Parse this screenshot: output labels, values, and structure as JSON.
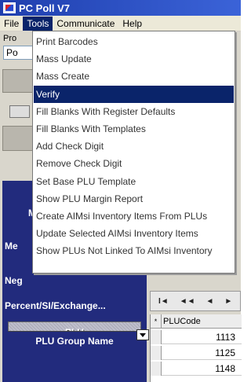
{
  "window": {
    "title": "PC Poll V7"
  },
  "menubar": {
    "items": [
      {
        "label": "File"
      },
      {
        "label": "Tools"
      },
      {
        "label": "Communicate"
      },
      {
        "label": "Help"
      }
    ],
    "active_index": 1
  },
  "tools_menu": {
    "items": [
      {
        "label": "Print Barcodes"
      },
      {
        "label": "Mass Update"
      },
      {
        "label": "Mass Create"
      },
      {
        "label": "Verify"
      },
      {
        "label": "Fill Blanks With Register Defaults"
      },
      {
        "label": "Fill Blanks With Templates"
      },
      {
        "label": "Add Check Digit"
      },
      {
        "label": "Remove Check Digit"
      },
      {
        "label": "Set Base PLU Template"
      },
      {
        "label": "Show PLU Margin Report"
      },
      {
        "label": "Create AIMsi Inventory Items From PLUs"
      },
      {
        "label": "Update Selected AIMsi Inventory Items"
      },
      {
        "label": "Show PLUs Not Linked To AIMsi Inventory"
      }
    ],
    "highlighted_index": 3
  },
  "background": {
    "group_label": "Pro",
    "group_value": "Po",
    "side_labels": [
      "M",
      "Me",
      "Neg",
      "Percent/SI/Exchange..."
    ],
    "plu_button": "PLU",
    "plu_group_name": "PLU Group Name",
    "grid": {
      "nav": [
        "I◄",
        "◄◄",
        "◄",
        "►"
      ],
      "header_marker": "*",
      "column": "PLUCode",
      "rows": [
        "1113",
        "1125",
        "1148"
      ]
    }
  }
}
